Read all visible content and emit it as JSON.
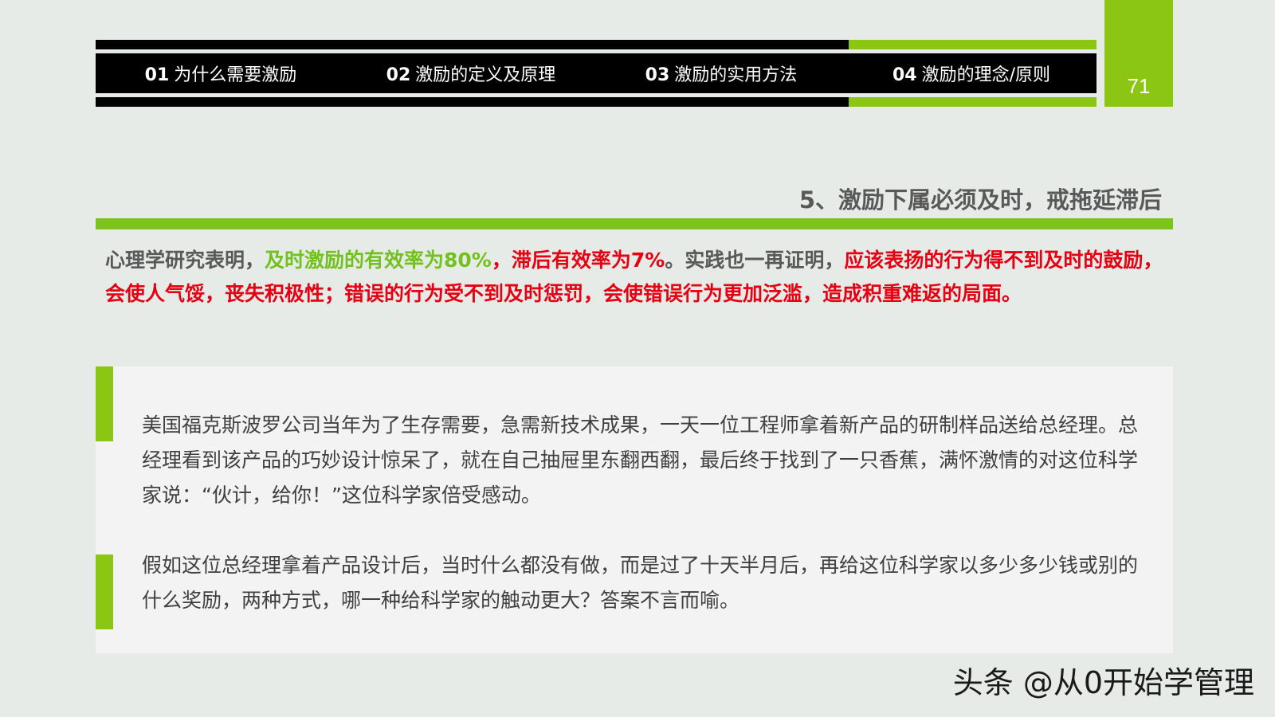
{
  "nav": {
    "items": [
      {
        "num": "01",
        "label": "为什么需要激励"
      },
      {
        "num": "02",
        "label": "激励的定义及原理"
      },
      {
        "num": "03",
        "label": "激励的实用方法"
      },
      {
        "num": "04",
        "label": "激励的理念/原则"
      }
    ],
    "active_index": 3,
    "page_number": "71"
  },
  "section": {
    "title": "5、激励下属必须及时，戒拖延滞后"
  },
  "highlight": {
    "part1": "心理学研究表明，",
    "part2_green": "及时激励的有效率为80%",
    "part3_red": "，滞后有效率为7%",
    "part4": "。实践也一再证明，",
    "part5_red": "应该表扬的行为得不到及时的鼓励，会使人气馁，丧失积极性；错误的行为受不到及时惩罚，会使错误行为更加泛滥，造成积重难返的局面。"
  },
  "story": {
    "paragraph1": "美国福克斯波罗公司当年为了生存需要，急需新技术成果，一天一位工程师拿着新产品的研制样品送给总经理。总经理看到该产品的巧妙设计惊呆了，就在自己抽屉里东翻西翻，最后终于找到了一只香蕉，满怀激情的对这位科学家说：“伙计，给你！”这位科学家倍受感动。",
    "paragraph2": "假如这位总经理拿着产品设计后，当时什么都没有做，而是过了十天半月后，再给这位科学家以多少多少钱或别的什么奖励，两种方式，哪一种给科学家的触动更大？答案不言而喻。"
  },
  "watermark": "头条 @从0开始学管理",
  "colors": {
    "accent_green": "#8cc614",
    "highlight_green": "#72c11d",
    "highlight_red": "#e60012",
    "nav_black": "#000000"
  }
}
